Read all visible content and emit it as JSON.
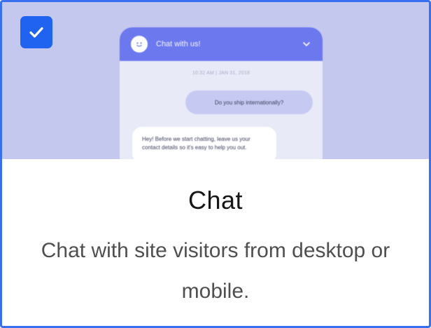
{
  "card": {
    "selected": true,
    "title": "Chat",
    "description": "Chat with site visitors from desktop or mobile."
  },
  "preview": {
    "header_title": "Chat with us!",
    "timestamp": "10:32 AM | JAN 31, 2018",
    "user_message": "Do you ship internationally?",
    "bot_message": "Hey! Before we start chatting, leave us your contact details so it's easy to help you out."
  },
  "colors": {
    "border": "#3a6ff0",
    "checkbox": "#1f63f0",
    "preview_bg": "#c4c7ee",
    "chat_header": "#6c78ee"
  },
  "icons": [
    "check-icon",
    "smiley-icon",
    "chevron-down-icon"
  ]
}
